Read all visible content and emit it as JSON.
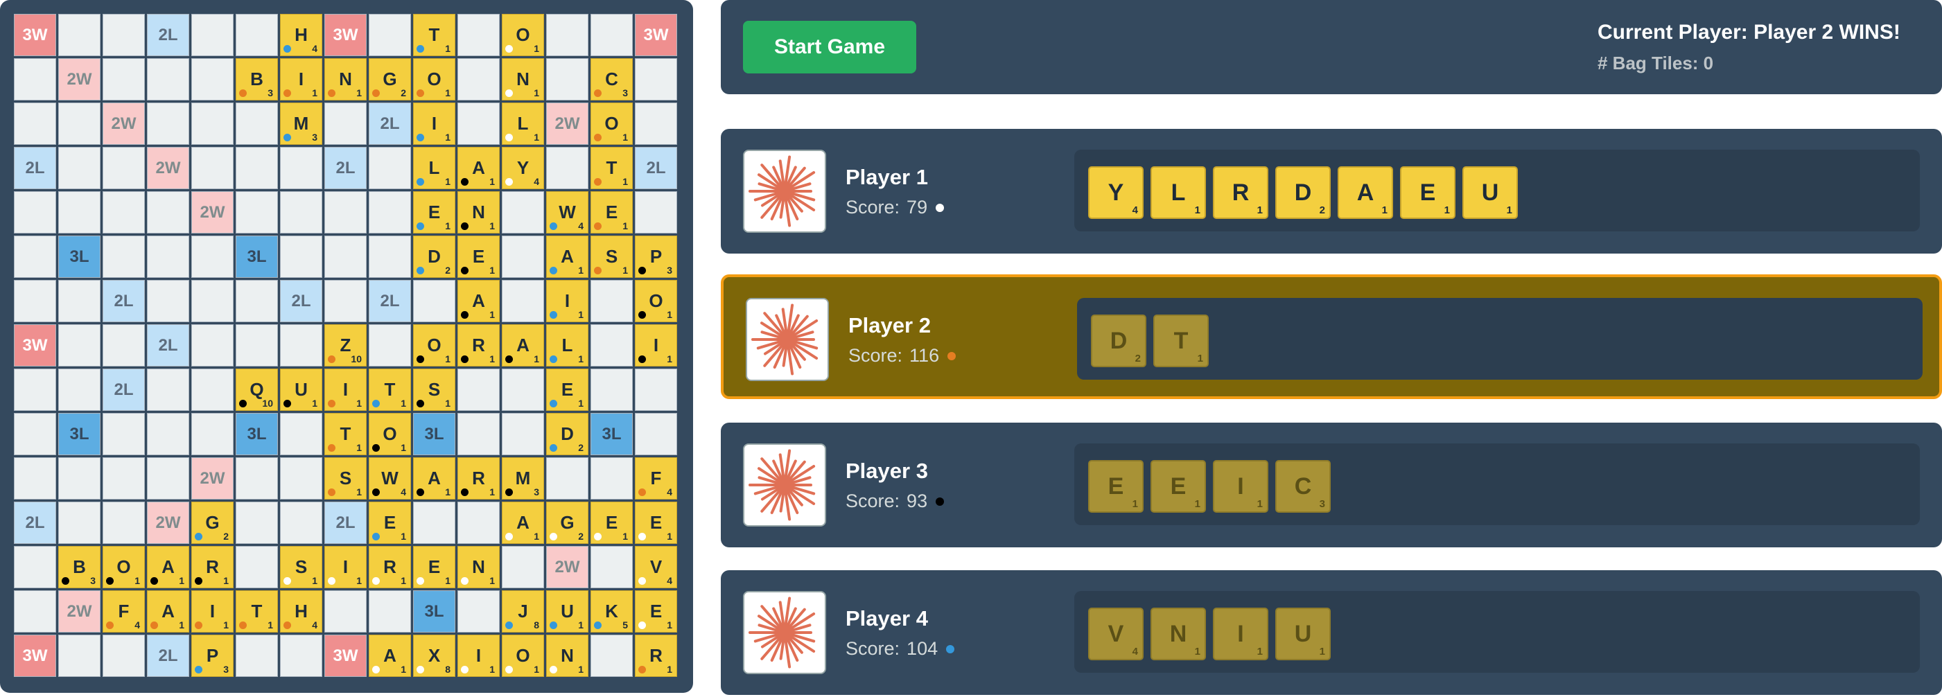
{
  "game": {
    "start_button_label": "Start Game",
    "status": "Current Player: Player 2 WINS!",
    "bag_tiles_label": "# Bag Tiles: 0"
  },
  "colors": {
    "p1_dot": "#ffffff",
    "p2_dot": "#e67e22",
    "p3_dot": "#000000",
    "p4_dot": "#3498db"
  },
  "board": {
    "premium": [
      "tw..dl...tw...tw",
      ".dw...........",
      "..dw....dl.......dw",
      "dl..dw...dl.....dl",
      "....dw..........",
      ".tl...tl........",
      "..dl...dl.dl.....",
      "tw..dl...........",
      "..dl.............",
      ".tl...tl..tl...tl",
      "....dw...........",
      "dl...dw...dl.....",
      "...........dw...",
      ".dw.......tl.....",
      "tw..dl...tw......"
    ],
    "premium_cells": [
      {
        "r": 0,
        "c": 0,
        "t": "3W"
      },
      {
        "r": 0,
        "c": 3,
        "t": "2L"
      },
      {
        "r": 0,
        "c": 7,
        "t": "3W"
      },
      {
        "r": 0,
        "c": 14,
        "t": "3W"
      },
      {
        "r": 1,
        "c": 1,
        "t": "2W"
      },
      {
        "r": 2,
        "c": 2,
        "t": "2W"
      },
      {
        "r": 2,
        "c": 8,
        "t": "2L"
      },
      {
        "r": 2,
        "c": 12,
        "t": "2W"
      },
      {
        "r": 3,
        "c": 0,
        "t": "2L"
      },
      {
        "r": 3,
        "c": 3,
        "t": "2W"
      },
      {
        "r": 3,
        "c": 7,
        "t": "2L"
      },
      {
        "r": 3,
        "c": 14,
        "t": "2L"
      },
      {
        "r": 4,
        "c": 4,
        "t": "2W"
      },
      {
        "r": 5,
        "c": 1,
        "t": "3L"
      },
      {
        "r": 5,
        "c": 5,
        "t": "3L"
      },
      {
        "r": 6,
        "c": 2,
        "t": "2L"
      },
      {
        "r": 6,
        "c": 6,
        "t": "2L"
      },
      {
        "r": 6,
        "c": 8,
        "t": "2L"
      },
      {
        "r": 7,
        "c": 0,
        "t": "3W"
      },
      {
        "r": 7,
        "c": 3,
        "t": "2L"
      },
      {
        "r": 8,
        "c": 2,
        "t": "2L"
      },
      {
        "r": 9,
        "c": 1,
        "t": "3L"
      },
      {
        "r": 9,
        "c": 5,
        "t": "3L"
      },
      {
        "r": 9,
        "c": 9,
        "t": "3L"
      },
      {
        "r": 9,
        "c": 13,
        "t": "3L"
      },
      {
        "r": 10,
        "c": 4,
        "t": "2W"
      },
      {
        "r": 11,
        "c": 0,
        "t": "2L"
      },
      {
        "r": 11,
        "c": 3,
        "t": "2W"
      },
      {
        "r": 11,
        "c": 7,
        "t": "2L"
      },
      {
        "r": 12,
        "c": 12,
        "t": "2W"
      },
      {
        "r": 13,
        "c": 1,
        "t": "2W"
      },
      {
        "r": 13,
        "c": 9,
        "t": "3L"
      },
      {
        "r": 14,
        "c": 0,
        "t": "3W"
      },
      {
        "r": 14,
        "c": 3,
        "t": "2L"
      },
      {
        "r": 14,
        "c": 7,
        "t": "3W"
      }
    ],
    "tiles": [
      {
        "r": 0,
        "c": 6,
        "l": "H",
        "p": "4",
        "o": "p4"
      },
      {
        "r": 0,
        "c": 9,
        "l": "T",
        "p": "1",
        "o": "p4"
      },
      {
        "r": 0,
        "c": 11,
        "l": "O",
        "p": "1",
        "o": "p1"
      },
      {
        "r": 1,
        "c": 5,
        "l": "B",
        "p": "3",
        "o": "p2"
      },
      {
        "r": 1,
        "c": 6,
        "l": "I",
        "p": "1",
        "o": "p2"
      },
      {
        "r": 1,
        "c": 7,
        "l": "N",
        "p": "1",
        "o": "p2"
      },
      {
        "r": 1,
        "c": 8,
        "l": "G",
        "p": "2",
        "o": "p2"
      },
      {
        "r": 1,
        "c": 9,
        "l": "O",
        "p": "1",
        "o": "p2"
      },
      {
        "r": 1,
        "c": 11,
        "l": "N",
        "p": "1",
        "o": "p1"
      },
      {
        "r": 1,
        "c": 13,
        "l": "C",
        "p": "3",
        "o": "p2"
      },
      {
        "r": 2,
        "c": 6,
        "l": "M",
        "p": "3",
        "o": "p4"
      },
      {
        "r": 2,
        "c": 9,
        "l": "I",
        "p": "1",
        "o": "p4"
      },
      {
        "r": 2,
        "c": 11,
        "l": "L",
        "p": "1",
        "o": "p1"
      },
      {
        "r": 2,
        "c": 13,
        "l": "O",
        "p": "1",
        "o": "p2"
      },
      {
        "r": 3,
        "c": 9,
        "l": "L",
        "p": "1",
        "o": "p4"
      },
      {
        "r": 3,
        "c": 10,
        "l": "A",
        "p": "1",
        "o": "p3"
      },
      {
        "r": 3,
        "c": 11,
        "l": "Y",
        "p": "4",
        "o": "p1"
      },
      {
        "r": 3,
        "c": 13,
        "l": "T",
        "p": "1",
        "o": "p2"
      },
      {
        "r": 4,
        "c": 9,
        "l": "E",
        "p": "1",
        "o": "p4"
      },
      {
        "r": 4,
        "c": 10,
        "l": "N",
        "p": "1",
        "o": "p3"
      },
      {
        "r": 4,
        "c": 12,
        "l": "W",
        "p": "4",
        "o": "p4"
      },
      {
        "r": 4,
        "c": 13,
        "l": "E",
        "p": "1",
        "o": "p2"
      },
      {
        "r": 5,
        "c": 9,
        "l": "D",
        "p": "2",
        "o": "p4"
      },
      {
        "r": 5,
        "c": 10,
        "l": "E",
        "p": "1",
        "o": "p3"
      },
      {
        "r": 5,
        "c": 12,
        "l": "A",
        "p": "1",
        "o": "p4"
      },
      {
        "r": 5,
        "c": 13,
        "l": "S",
        "p": "1",
        "o": "p2"
      },
      {
        "r": 5,
        "c": 14,
        "l": "P",
        "p": "3",
        "o": "p3"
      },
      {
        "r": 6,
        "c": 10,
        "l": "A",
        "p": "1",
        "o": "p3"
      },
      {
        "r": 6,
        "c": 12,
        "l": "I",
        "p": "1",
        "o": "p4"
      },
      {
        "r": 6,
        "c": 14,
        "l": "O",
        "p": "1",
        "o": "p3"
      },
      {
        "r": 7,
        "c": 7,
        "l": "Z",
        "p": "10",
        "o": "p2"
      },
      {
        "r": 7,
        "c": 9,
        "l": "O",
        "p": "1",
        "o": "p3"
      },
      {
        "r": 7,
        "c": 10,
        "l": "R",
        "p": "1",
        "o": "p3"
      },
      {
        "r": 7,
        "c": 11,
        "l": "A",
        "p": "1",
        "o": "p3"
      },
      {
        "r": 7,
        "c": 12,
        "l": "L",
        "p": "1",
        "o": "p4"
      },
      {
        "r": 7,
        "c": 14,
        "l": "I",
        "p": "1",
        "o": "p3"
      },
      {
        "r": 8,
        "c": 5,
        "l": "Q",
        "p": "10",
        "o": "p3"
      },
      {
        "r": 8,
        "c": 6,
        "l": "U",
        "p": "1",
        "o": "p3"
      },
      {
        "r": 8,
        "c": 7,
        "l": "I",
        "p": "1",
        "o": "p2"
      },
      {
        "r": 8,
        "c": 8,
        "l": "T",
        "p": "1",
        "o": "p4"
      },
      {
        "r": 8,
        "c": 9,
        "l": "S",
        "p": "1",
        "o": "p3"
      },
      {
        "r": 8,
        "c": 12,
        "l": "E",
        "p": "1",
        "o": "p4"
      },
      {
        "r": 9,
        "c": 7,
        "l": "T",
        "p": "1",
        "o": "p2"
      },
      {
        "r": 9,
        "c": 8,
        "l": "O",
        "p": "1",
        "o": "p3"
      },
      {
        "r": 9,
        "c": 12,
        "l": "D",
        "p": "2",
        "o": "p4"
      },
      {
        "r": 10,
        "c": 7,
        "l": "S",
        "p": "1",
        "o": "p2"
      },
      {
        "r": 10,
        "c": 8,
        "l": "W",
        "p": "4",
        "o": "p3"
      },
      {
        "r": 10,
        "c": 9,
        "l": "A",
        "p": "1",
        "o": "p3"
      },
      {
        "r": 10,
        "c": 10,
        "l": "R",
        "p": "1",
        "o": "p3"
      },
      {
        "r": 10,
        "c": 11,
        "l": "M",
        "p": "3",
        "o": "p3"
      },
      {
        "r": 10,
        "c": 14,
        "l": "F",
        "p": "4",
        "o": "p2"
      },
      {
        "r": 11,
        "c": 4,
        "l": "G",
        "p": "2",
        "o": "p4"
      },
      {
        "r": 11,
        "c": 8,
        "l": "E",
        "p": "1",
        "o": "p4"
      },
      {
        "r": 11,
        "c": 11,
        "l": "A",
        "p": "1",
        "o": "p1"
      },
      {
        "r": 11,
        "c": 12,
        "l": "G",
        "p": "2",
        "o": "p1"
      },
      {
        "r": 11,
        "c": 13,
        "l": "E",
        "p": "1",
        "o": "p1"
      },
      {
        "r": 11,
        "c": 14,
        "l": "E",
        "p": "1",
        "o": "p1"
      },
      {
        "r": 12,
        "c": 1,
        "l": "B",
        "p": "3",
        "o": "p3"
      },
      {
        "r": 12,
        "c": 2,
        "l": "O",
        "p": "1",
        "o": "p3"
      },
      {
        "r": 12,
        "c": 3,
        "l": "A",
        "p": "1",
        "o": "p3"
      },
      {
        "r": 12,
        "c": 4,
        "l": "R",
        "p": "1",
        "o": "p3"
      },
      {
        "r": 12,
        "c": 6,
        "l": "S",
        "p": "1",
        "o": "p1"
      },
      {
        "r": 12,
        "c": 7,
        "l": "I",
        "p": "1",
        "o": "p1"
      },
      {
        "r": 12,
        "c": 8,
        "l": "R",
        "p": "1",
        "o": "p1"
      },
      {
        "r": 12,
        "c": 9,
        "l": "E",
        "p": "1",
        "o": "p1"
      },
      {
        "r": 12,
        "c": 10,
        "l": "N",
        "p": "1",
        "o": "p1"
      },
      {
        "r": 12,
        "c": 14,
        "l": "V",
        "p": "4",
        "o": "p1"
      },
      {
        "r": 13,
        "c": 2,
        "l": "F",
        "p": "4",
        "o": "p2"
      },
      {
        "r": 13,
        "c": 3,
        "l": "A",
        "p": "1",
        "o": "p2"
      },
      {
        "r": 13,
        "c": 4,
        "l": "I",
        "p": "1",
        "o": "p2"
      },
      {
        "r": 13,
        "c": 5,
        "l": "T",
        "p": "1",
        "o": "p2"
      },
      {
        "r": 13,
        "c": 6,
        "l": "H",
        "p": "4",
        "o": "p2"
      },
      {
        "r": 13,
        "c": 11,
        "l": "J",
        "p": "8",
        "o": "p4"
      },
      {
        "r": 13,
        "c": 12,
        "l": "U",
        "p": "1",
        "o": "p4"
      },
      {
        "r": 13,
        "c": 13,
        "l": "K",
        "p": "5",
        "o": "p4"
      },
      {
        "r": 13,
        "c": 14,
        "l": "E",
        "p": "1",
        "o": "p1"
      },
      {
        "r": 14,
        "c": 4,
        "l": "P",
        "p": "3",
        "o": "p4"
      },
      {
        "r": 14,
        "c": 8,
        "l": "A",
        "p": "1",
        "o": "p1"
      },
      {
        "r": 14,
        "c": 9,
        "l": "X",
        "p": "8",
        "o": "p1"
      },
      {
        "r": 14,
        "c": 10,
        "l": "I",
        "p": "1",
        "o": "p1"
      },
      {
        "r": 14,
        "c": 11,
        "l": "O",
        "p": "1",
        "o": "p1"
      },
      {
        "r": 14,
        "c": 12,
        "l": "N",
        "p": "1",
        "o": "p1"
      },
      {
        "r": 14,
        "c": 14,
        "l": "R",
        "p": "1",
        "o": "p2"
      }
    ]
  },
  "players": [
    {
      "name": "Player 1",
      "score_label": "Score:",
      "score": "79",
      "avatar_icon": "splat-icon",
      "active": false,
      "dim": false,
      "rack": [
        {
          "l": "Y",
          "p": "4"
        },
        {
          "l": "L",
          "p": "1"
        },
        {
          "l": "R",
          "p": "1"
        },
        {
          "l": "D",
          "p": "2"
        },
        {
          "l": "A",
          "p": "1"
        },
        {
          "l": "E",
          "p": "1"
        },
        {
          "l": "U",
          "p": "1"
        }
      ]
    },
    {
      "name": "Player 2",
      "score_label": "Score:",
      "score": "116",
      "avatar_icon": "splat-icon",
      "active": true,
      "dim": true,
      "rack": [
        {
          "l": "D",
          "p": "2"
        },
        {
          "l": "T",
          "p": "1"
        }
      ]
    },
    {
      "name": "Player 3",
      "score_label": "Score:",
      "score": "93",
      "avatar_icon": "splat-icon",
      "active": false,
      "dim": true,
      "rack": [
        {
          "l": "E",
          "p": "1"
        },
        {
          "l": "E",
          "p": "1"
        },
        {
          "l": "I",
          "p": "1"
        },
        {
          "l": "C",
          "p": "3"
        }
      ]
    },
    {
      "name": "Player 4",
      "score_label": "Score:",
      "score": "104",
      "avatar_icon": "splat-icon",
      "active": false,
      "dim": true,
      "rack": [
        {
          "l": "V",
          "p": "4"
        },
        {
          "l": "N",
          "p": "1"
        },
        {
          "l": "I",
          "p": "1"
        },
        {
          "l": "U",
          "p": "1"
        }
      ]
    }
  ]
}
